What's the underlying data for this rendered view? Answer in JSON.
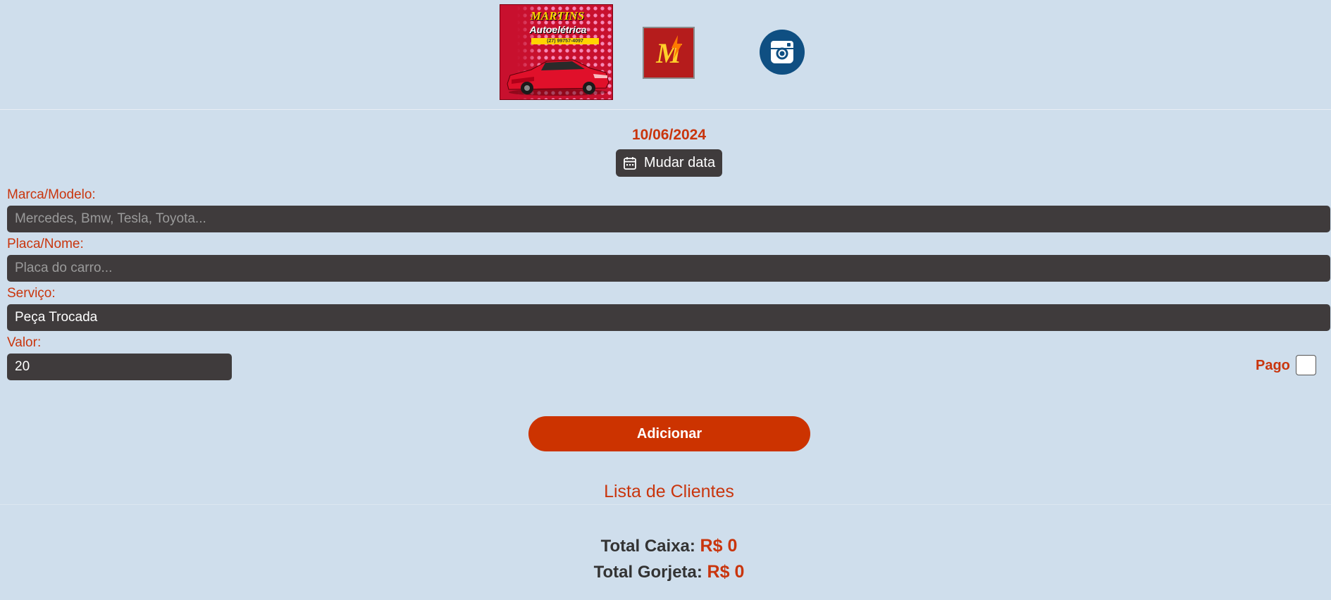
{
  "header": {
    "logo_main": {
      "brand": "MARTINS",
      "subtitle": "Autoelétrica",
      "phone": "(27) 99757-4097"
    },
    "logo_m": {
      "letter": "M"
    },
    "instagram_icon": "instagram-icon"
  },
  "date": {
    "value": "10/06/2024",
    "change_button": "Mudar data",
    "icon": "calendar-icon"
  },
  "form": {
    "marca": {
      "label": "Marca/Modelo:",
      "value": "",
      "placeholder": "Mercedes, Bmw, Tesla, Toyota..."
    },
    "placa": {
      "label": "Placa/Nome:",
      "value": "",
      "placeholder": "Placa do carro..."
    },
    "servico": {
      "label": "Serviço:",
      "value": "Peça Trocada",
      "placeholder": ""
    },
    "valor": {
      "label": "Valor:",
      "value": "20"
    },
    "pago": {
      "label": "Pago",
      "checked": false
    },
    "submit": "Adicionar"
  },
  "list": {
    "title": "Lista de Clientes"
  },
  "totals": {
    "caixa_label": "Total Caixa:",
    "caixa_value": "R$ 0",
    "gorjeta_label": "Total Gorjeta:",
    "gorjeta_value": "R$ 0"
  },
  "colors": {
    "background": "#cfdeec",
    "accent": "#c9350d",
    "field": "#3f3b3c",
    "button": "#cc3300",
    "instagram": "#0f4f82"
  }
}
